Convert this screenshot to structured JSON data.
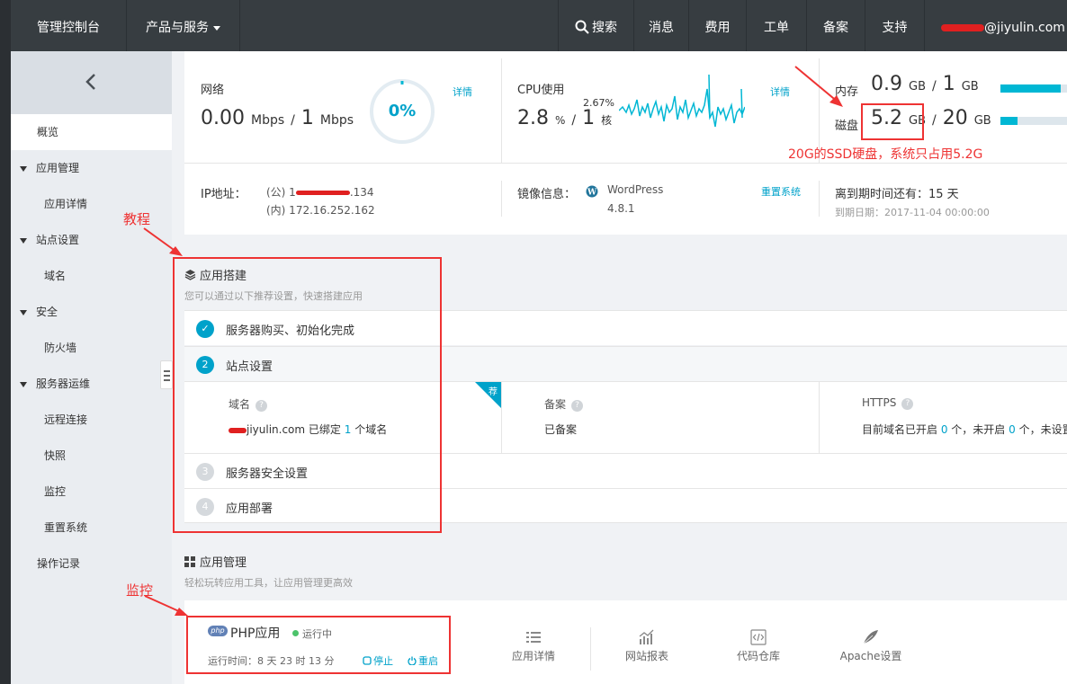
{
  "topbar": {
    "console": "管理控制台",
    "products": "产品与服务",
    "search": "搜索",
    "messages": "消息",
    "fees": "费用",
    "tickets": "工单",
    "filing": "备案",
    "support": "支持",
    "user": "@jiyulin.com"
  },
  "sidebar": {
    "back_icon": "chevron-left-icon",
    "items": [
      {
        "label": "概览"
      },
      {
        "label": "应用管理"
      },
      {
        "label": "应用详情"
      },
      {
        "label": "站点设置"
      },
      {
        "label": "域名"
      },
      {
        "label": "安全"
      },
      {
        "label": "防火墙"
      },
      {
        "label": "服务器运维"
      },
      {
        "label": "远程连接"
      },
      {
        "label": "快照"
      },
      {
        "label": "监控"
      },
      {
        "label": "重置系统"
      },
      {
        "label": "操作记录"
      }
    ]
  },
  "metrics": {
    "network": {
      "label": "网络",
      "value": "0.00",
      "unit1": "Mbps",
      "sep": "/",
      "max": "1",
      "unit2": "Mbps",
      "gauge": "0%",
      "detail": "详情"
    },
    "cpu": {
      "label": "CPU使用",
      "value": "2.8",
      "unit1": "%",
      "sep": "/",
      "cores": "1",
      "unit2": "核",
      "peak": "2.67%",
      "detail": "详情"
    },
    "memory": {
      "label": "内存",
      "value": "0.9",
      "unit1": "GB",
      "sep": "/",
      "max": "1",
      "unit2": "GB",
      "fill": 0.9
    },
    "disk": {
      "label": "磁盘",
      "value": "5.2",
      "unit1": "GB",
      "sep": "/",
      "max": "20",
      "unit2": "GB",
      "fill": 0.26
    }
  },
  "info": {
    "ip_label": "IP地址：",
    "ip_public": "(公) 1",
    "ip_public_tail": ".134",
    "ip_private": "(内) 172.16.252.162",
    "image_label": "镜像信息：",
    "image_name": "WordPress",
    "image_version": "4.8.1",
    "reset": "重置系统",
    "expire_label": "离到期时间还有：15 天",
    "expire_date": "到期日期：2017-11-04 00:00:00"
  },
  "annotations": {
    "disk_note": "20G的SSD硬盘，系统只占用5.2G",
    "tutorial": "教程",
    "monitor": "监控"
  },
  "build": {
    "title": "应用搭建",
    "subtitle": "您可以通过以下推荐设置，快速搭建应用",
    "steps": [
      {
        "num": "✓",
        "label": "服务器购买、初始化完成"
      },
      {
        "num": "2",
        "label": "站点设置"
      },
      {
        "num": "3",
        "label": "服务器安全设置"
      },
      {
        "num": "4",
        "label": "应用部署"
      }
    ],
    "badge": "荐",
    "domain": {
      "label": "域名",
      "value_pre": "jiyulin.com 已绑定 ",
      "count": "1",
      "value_post": " 个域名"
    },
    "filing": {
      "label": "备案",
      "value": "已备案"
    },
    "https": {
      "label": "HTTPS",
      "pre": "目前域名已开启 ",
      "on": "0",
      "mid": " 个，未开启 ",
      "off": "0",
      "post": " 个，未设置"
    }
  },
  "manage": {
    "title": "应用管理",
    "subtitle": "轻松玩转应用工具，让应用管理更高效",
    "app_name": "PHP应用",
    "php_badge": "php",
    "status": "运行中",
    "uptime": "运行时间：8 天 23 时 13 分",
    "stop": "停止",
    "restart": "重启",
    "tools": [
      {
        "label": "应用详情",
        "icon": "list-icon"
      },
      {
        "label": "网站报表",
        "icon": "chart-icon"
      },
      {
        "label": "代码仓库",
        "icon": "code-icon"
      },
      {
        "label": "Apache设置",
        "icon": "feather-icon"
      }
    ]
  },
  "colors": {
    "accent": "#00a2ca",
    "bar": "#00b7d4",
    "annotation": "#e33333",
    "topbar": "#373d41"
  }
}
